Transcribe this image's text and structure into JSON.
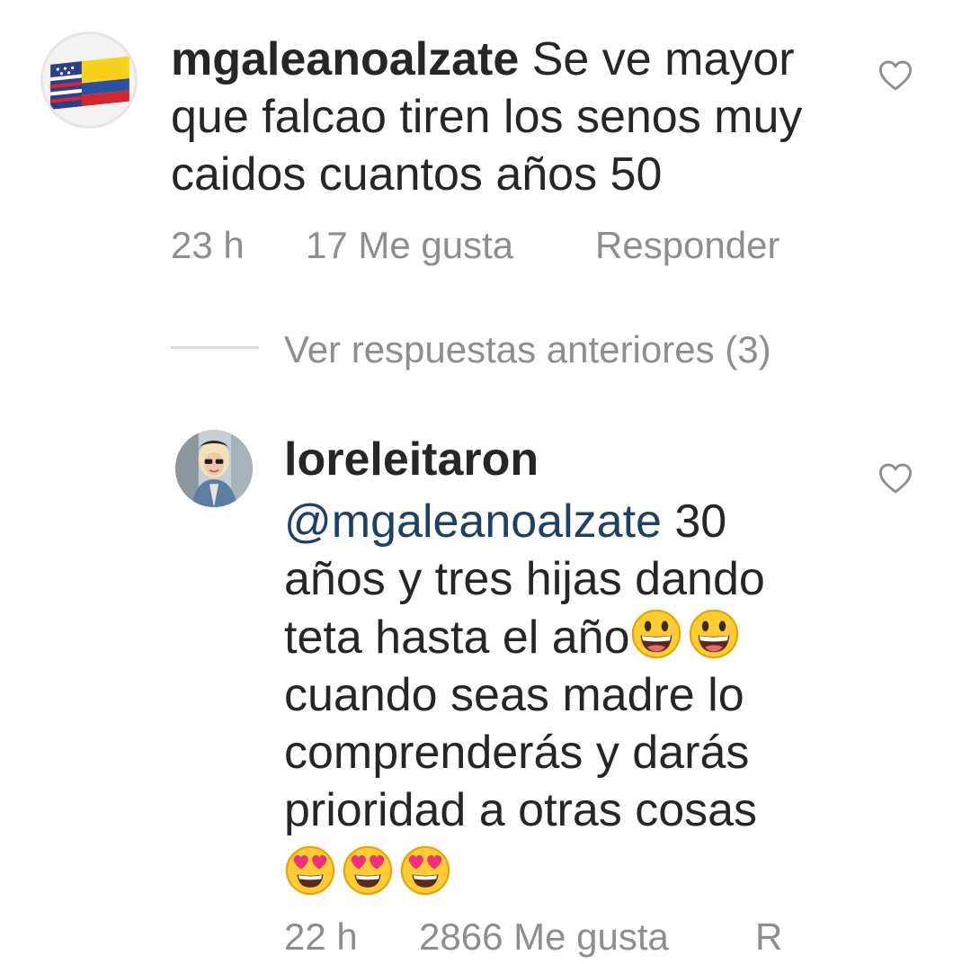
{
  "comments": [
    {
      "username": "mgaleanoalzate",
      "text_lines": [
        "Se ve mayor",
        "que falcao tiren los senos muy",
        "caidos cuantos años 50"
      ],
      "time": "23 h",
      "likes": "17 Me gusta",
      "reply_label": "Responder",
      "avatar_icon": "flag-avatar-icon",
      "like_icon": "heart-outline-icon"
    },
    {
      "username": "loreleitaron",
      "mention": "@mgaleanoalzate",
      "text_lines": [
        " 30",
        "años y tres hijas dando",
        "teta hasta el año",
        "cuando seas madre lo",
        "comprenderás y darás",
        "prioridad a otras cosas"
      ],
      "emojis_line3": [
        "grinning-face-emoji",
        "grinning-face-emoji"
      ],
      "emojis_line7": [
        "heart-eyes-emoji",
        "heart-eyes-emoji",
        "heart-eyes-emoji"
      ],
      "time": "22 h",
      "likes": "2866 Me gusta",
      "reply_label": "R",
      "avatar_icon": "profile-photo-avatar",
      "like_icon": "heart-outline-icon"
    }
  ],
  "view_replies": "Ver respuestas anteriores (3)",
  "colors": {
    "text": "#262626",
    "meta": "#8e8e8e",
    "mention": "#1e3f66",
    "divider": "#dbdbdb"
  }
}
